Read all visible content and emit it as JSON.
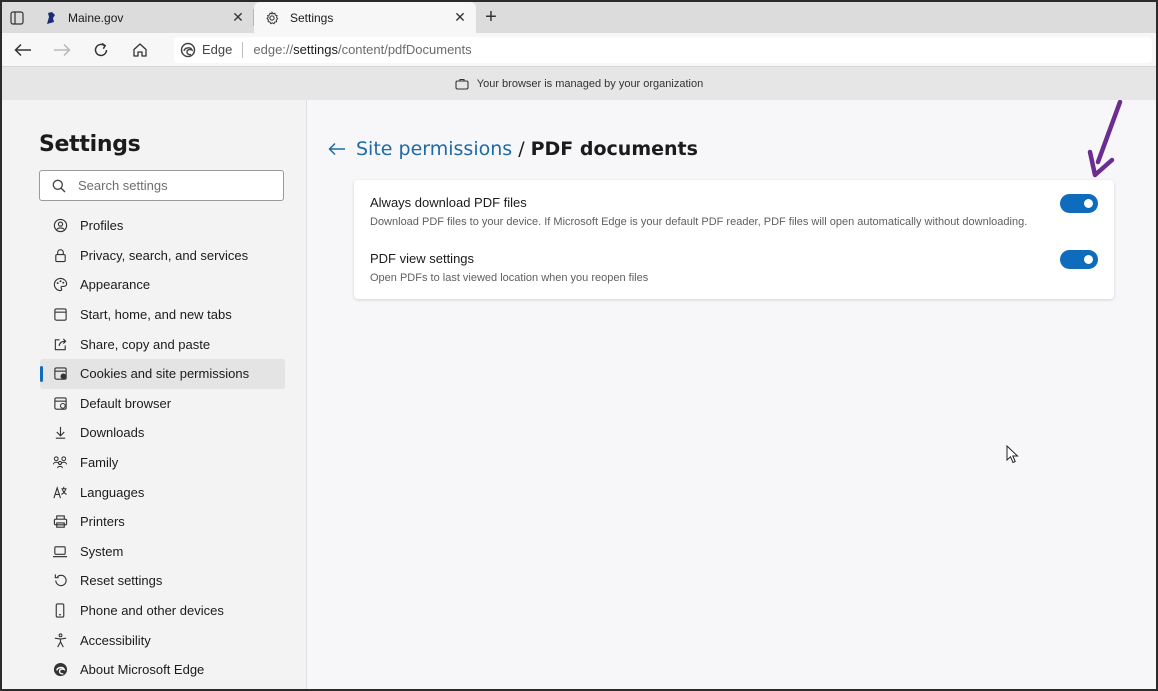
{
  "tabs": {
    "items": [
      {
        "title": "Maine.gov",
        "icon": "maine-gov-favicon"
      },
      {
        "title": "Settings",
        "icon": "gear-icon"
      }
    ],
    "close_glyph": "✕",
    "new_tab_glyph": "+"
  },
  "address_bar": {
    "brand": "Edge",
    "url_prefix": "edge://",
    "url_host": "settings",
    "url_path": "/content/pdfDocuments"
  },
  "banner": {
    "text": "Your browser is managed by your organization"
  },
  "sidebar": {
    "title": "Settings",
    "search_placeholder": "Search settings",
    "selected_index": 5,
    "items": [
      {
        "label": "Profiles",
        "icon": "profile-icon"
      },
      {
        "label": "Privacy, search, and services",
        "icon": "lock-icon"
      },
      {
        "label": "Appearance",
        "icon": "palette-icon"
      },
      {
        "label": "Start, home, and new tabs",
        "icon": "power-icon"
      },
      {
        "label": "Share, copy and paste",
        "icon": "share-icon"
      },
      {
        "label": "Cookies and site permissions",
        "icon": "cookie-icon"
      },
      {
        "label": "Default browser",
        "icon": "browser-icon"
      },
      {
        "label": "Downloads",
        "icon": "download-icon"
      },
      {
        "label": "Family",
        "icon": "family-icon"
      },
      {
        "label": "Languages",
        "icon": "language-icon"
      },
      {
        "label": "Printers",
        "icon": "printer-icon"
      },
      {
        "label": "System",
        "icon": "laptop-icon"
      },
      {
        "label": "Reset settings",
        "icon": "reset-icon"
      },
      {
        "label": "Phone and other devices",
        "icon": "phone-icon"
      },
      {
        "label": "Accessibility",
        "icon": "accessibility-icon"
      },
      {
        "label": "About Microsoft Edge",
        "icon": "edge-logo-icon"
      }
    ]
  },
  "main": {
    "breadcrumb_parent": "Site permissions",
    "breadcrumb_separator": "/",
    "breadcrumb_current": "PDF documents",
    "settings": [
      {
        "title": "Always download PDF files",
        "description": "Download PDF files to your device. If Microsoft Edge is your default PDF reader, PDF files will open automatically without downloading.",
        "enabled": true
      },
      {
        "title": "PDF view settings",
        "description": "Open PDFs to last viewed location when you reopen files",
        "enabled": true
      }
    ]
  },
  "colors": {
    "accent": "#0f6cbd",
    "link": "#1d6aa5",
    "annotation_arrow": "#6b2d8f"
  }
}
